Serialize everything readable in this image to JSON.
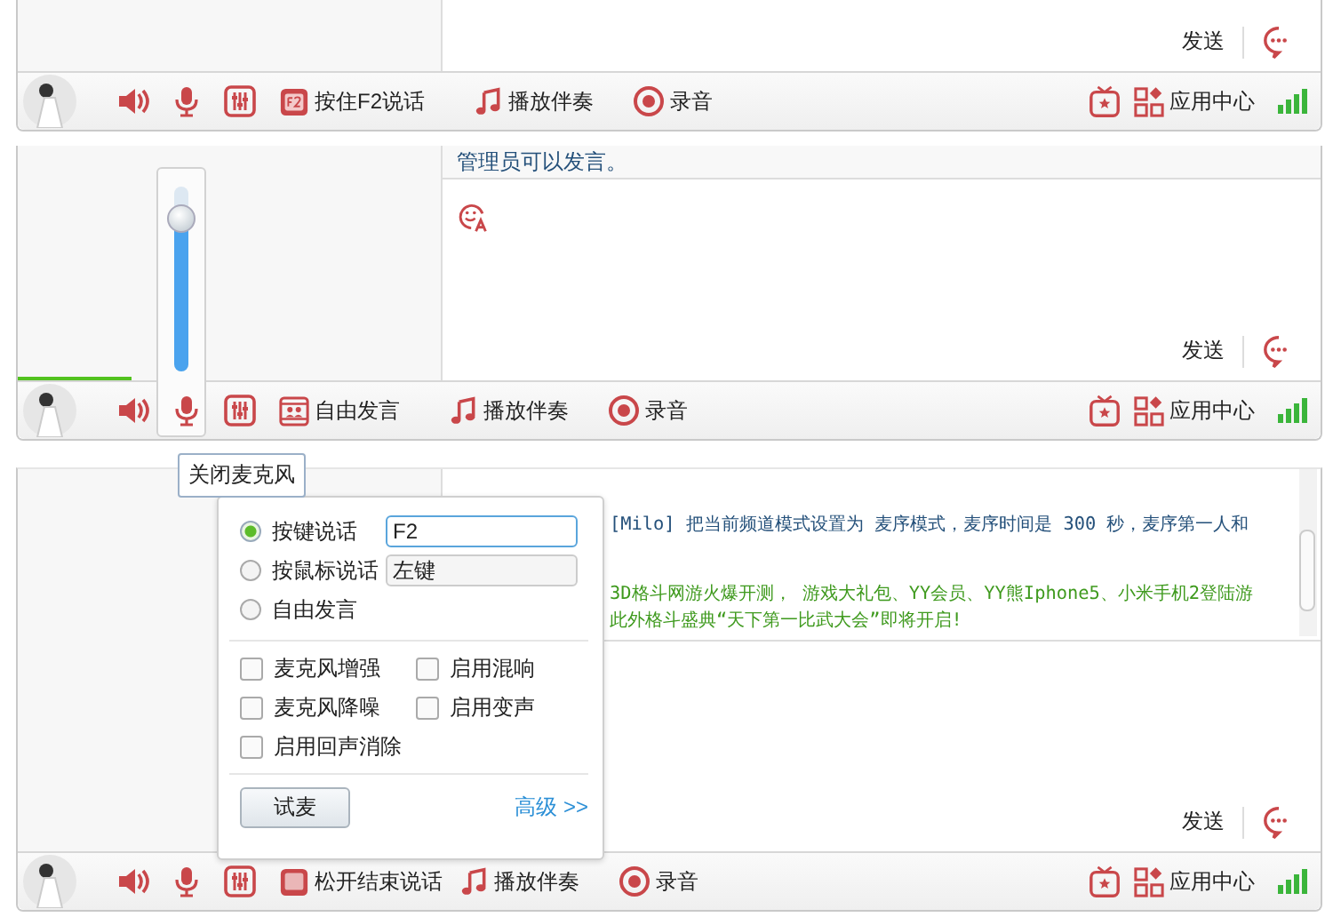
{
  "panels": [
    {
      "send_label": "发送",
      "toolbar": {
        "talk": {
          "kind": "f2",
          "label": "按住F2说话"
        },
        "accompany_label": "播放伴奏",
        "record_label": "录音",
        "app_center_label": "应用中心"
      }
    },
    {
      "chat_text": "管理员可以发言。",
      "send_label": "发送",
      "voice_meter": {
        "level": 0.27
      },
      "mic_volume": {
        "level": 0.82
      },
      "tooltip": "关闭麦克风",
      "toolbar": {
        "talk": {
          "kind": "free",
          "label": "自由发言"
        },
        "accompany_label": "播放伴奏",
        "record_label": "录音",
        "app_center_label": "应用中心"
      }
    },
    {
      "messages": [
        {
          "kind": "system",
          "text": "[Milo] 把当前频道模式设置为 麦序模式，麦序时间是 300 秒，麦序第一人和"
        },
        {
          "kind": "ad",
          "text": "3D格斗网游火爆开测， 游戏大礼包、YY会员、YY熊Iphone5、小米手机2登陆游"
        },
        {
          "kind": "ad",
          "text": "此外格斗盛典“天下第一比武大会”即将开启!"
        }
      ],
      "send_label": "发送",
      "voice_settings": {
        "modes": [
          {
            "label": "按键说话",
            "selected": true,
            "field": {
              "value": "F2",
              "focused": true
            }
          },
          {
            "label": "按鼠标说话",
            "selected": false,
            "field": {
              "value": "左键",
              "focused": false
            }
          },
          {
            "label": "自由发言",
            "selected": false
          }
        ],
        "options": [
          {
            "label": "麦克风增强",
            "checked": false
          },
          {
            "label": "启用混响",
            "checked": false
          },
          {
            "label": "麦克风降噪",
            "checked": false
          },
          {
            "label": "启用变声",
            "checked": false
          },
          {
            "label": "启用回声消除",
            "checked": false
          }
        ],
        "test_button": "试麦",
        "advanced_link": "高级 >>"
      },
      "toolbar": {
        "talk": {
          "kind": "release",
          "label": "松开结束说话"
        },
        "accompany_label": "播放伴奏",
        "record_label": "录音",
        "app_center_label": "应用中心"
      }
    }
  ]
}
